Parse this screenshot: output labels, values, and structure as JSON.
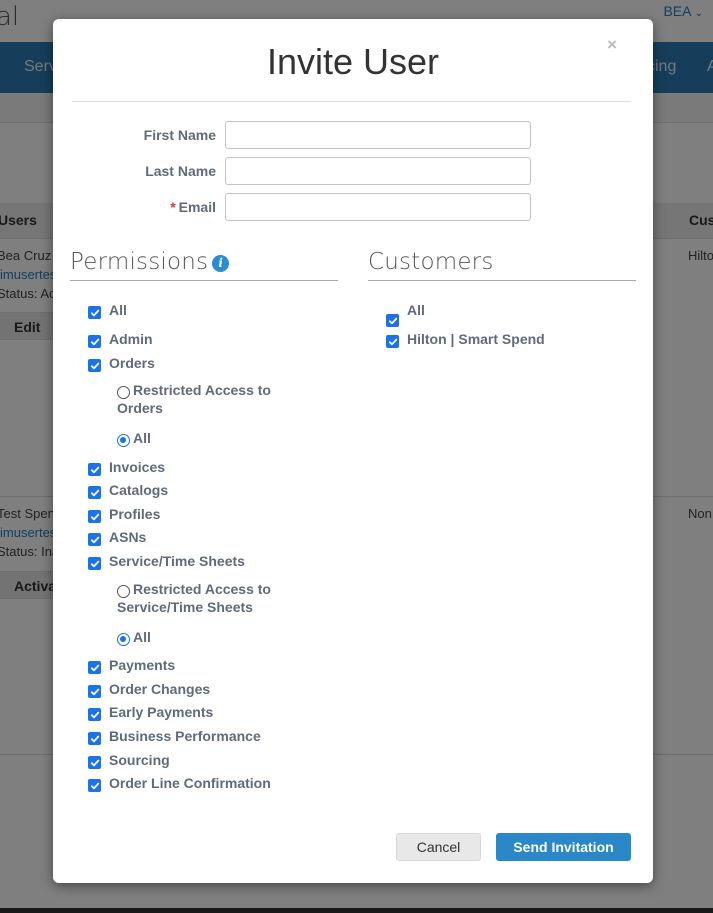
{
  "background": {
    "logo_fragment": "al",
    "user_menu": "BEA",
    "nav_items": [
      "Serv",
      "cing",
      "A"
    ],
    "table_headers": [
      "Users",
      "Cus"
    ],
    "rows": [
      {
        "name": "Bea Cruz",
        "email": "imusertes",
        "status": "Status: Ac",
        "customer": "Hilto",
        "action": "Edit"
      },
      {
        "name": "Test Spend",
        "email": "imusertes",
        "status": "Status: Ina",
        "customer": "Non",
        "action": "Activa"
      }
    ]
  },
  "modal": {
    "title": "Invite User",
    "close_label": "×",
    "fields": {
      "first_name": {
        "label": "First Name",
        "value": "",
        "placeholder": ""
      },
      "last_name": {
        "label": "Last Name",
        "value": "",
        "placeholder": ""
      },
      "email": {
        "label": "Email",
        "required_marker": "*",
        "value": "",
        "placeholder": ""
      }
    },
    "permissions": {
      "title": "Permissions",
      "info_icon": "i",
      "items": [
        {
          "label": "All",
          "checked": true
        },
        {
          "label": "Admin",
          "checked": true
        },
        {
          "label": "Orders",
          "checked": true
        },
        {
          "label": "Invoices",
          "checked": true
        },
        {
          "label": "Catalogs",
          "checked": true
        },
        {
          "label": "Profiles",
          "checked": true
        },
        {
          "label": "ASNs",
          "checked": true
        },
        {
          "label": "Service/Time Sheets",
          "checked": true
        },
        {
          "label": "Payments",
          "checked": true
        },
        {
          "label": "Order Changes",
          "checked": true
        },
        {
          "label": "Early Payments",
          "checked": true
        },
        {
          "label": "Business Performance",
          "checked": true
        },
        {
          "label": "Sourcing",
          "checked": true
        },
        {
          "label": "Order Line Confirmation",
          "checked": true
        }
      ],
      "orders_access": {
        "restricted_label": "Restricted Access to Orders",
        "restricted_line1": "Restricted Access to",
        "restricted_line2": "Orders",
        "all_label": "All",
        "selected": "All"
      },
      "service_access": {
        "restricted_label": "Restricted Access to Service/Time Sheets",
        "restricted_line1": "Restricted Access to",
        "restricted_line2": "Service/Time Sheets",
        "all_label": "All",
        "selected": "All"
      }
    },
    "customers": {
      "title": "Customers",
      "items": [
        {
          "label": "All",
          "checked": true
        },
        {
          "label": "Hilton | Smart Spend",
          "checked": true
        }
      ]
    },
    "buttons": {
      "cancel": "Cancel",
      "send": "Send Invitation"
    }
  },
  "colors": {
    "primary": "#2a87c8",
    "checkbox": "#1a73e8",
    "required": "#e0302a",
    "label": "#5f6b7c"
  }
}
